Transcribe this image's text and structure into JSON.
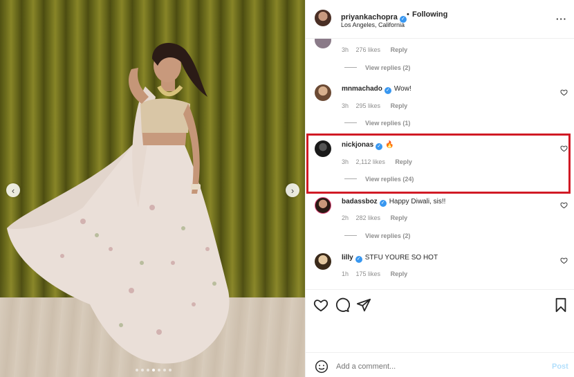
{
  "header": {
    "username": "priyankachopra",
    "separator": "•",
    "follow_status": "Following",
    "location": "Los Angeles, California",
    "more_icon": "more-horizontal-icon"
  },
  "comments": [
    {
      "username": "",
      "text": "",
      "time": "3h",
      "likes": "276 likes",
      "reply": "Reply",
      "view_replies": "View replies (2)"
    },
    {
      "username": "mnmachado",
      "text": "Wow!",
      "time": "3h",
      "likes": "295 likes",
      "reply": "Reply",
      "view_replies": "View replies (1)"
    },
    {
      "username": "nickjonas",
      "text": "🔥",
      "time": "3h",
      "likes": "2,112 likes",
      "reply": "Reply",
      "view_replies": "View replies (24)"
    },
    {
      "username": "badassboz",
      "text": "Happy Diwali, sis!!",
      "time": "2h",
      "likes": "282 likes",
      "reply": "Reply",
      "view_replies": "View replies (2)"
    },
    {
      "username": "lilly",
      "text": "STFU YOURE SO HOT",
      "time": "1h",
      "likes": "175 likes",
      "reply": "Reply",
      "view_replies": ""
    }
  ],
  "actions": {
    "like_icon": "heart-icon",
    "comment_icon": "comment-icon",
    "share_icon": "send-icon",
    "save_icon": "bookmark-icon"
  },
  "add_comment": {
    "placeholder": "Add a comment...",
    "post_label": "Post"
  },
  "carousel": {
    "prev_label": "‹",
    "next_label": "›",
    "slide_count": 7,
    "active_slide": 3
  },
  "colors": {
    "verified_blue": "#3897f0",
    "highlight_red": "#d11a25",
    "post_disabled": "#b2dffc"
  }
}
